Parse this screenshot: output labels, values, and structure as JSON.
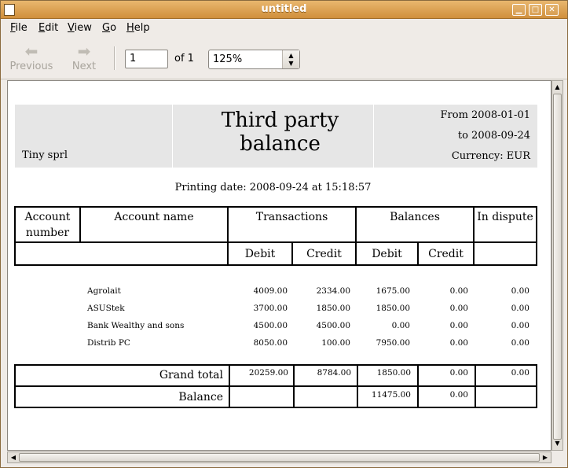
{
  "window": {
    "title": "untitled",
    "minimize": "▁",
    "maximize": "□",
    "close": "✕"
  },
  "menu": [
    {
      "label": "File",
      "u": "F",
      "rest": "ile"
    },
    {
      "label": "Edit",
      "u": "E",
      "rest": "dit"
    },
    {
      "label": "View",
      "u": "V",
      "rest": "iew"
    },
    {
      "label": "Go",
      "u": "G",
      "rest": "o"
    },
    {
      "label": "Help",
      "u": "H",
      "rest": "elp"
    }
  ],
  "toolbar": {
    "previous_label": "Previous",
    "next_label": "Next",
    "page_value": "1",
    "page_of": "of 1",
    "zoom_value": "125%"
  },
  "report": {
    "company": "Tiny sprl",
    "title": "Third party balance",
    "from": "From 2008-01-01",
    "to": "to 2008-09-24",
    "currency": "Currency: EUR",
    "printing_date": "Printing date: 2008-09-24 at 15:18:57",
    "columns": {
      "account_number": "Account number",
      "account_name": "Account name",
      "transactions": "Transactions",
      "balances": "Balances",
      "in_dispute": "In dispute",
      "debit": "Debit",
      "credit": "Credit"
    },
    "rows": [
      {
        "name": "Agrolait",
        "t_debit": "4009.00",
        "t_credit": "2334.00",
        "b_debit": "1675.00",
        "b_credit": "0.00",
        "dispute": "0.00"
      },
      {
        "name": "ASUStek",
        "t_debit": "3700.00",
        "t_credit": "1850.00",
        "b_debit": "1850.00",
        "b_credit": "0.00",
        "dispute": "0.00"
      },
      {
        "name": "Bank Wealthy and sons",
        "t_debit": "4500.00",
        "t_credit": "4500.00",
        "b_debit": "0.00",
        "b_credit": "0.00",
        "dispute": "0.00"
      },
      {
        "name": "Distrib PC",
        "t_debit": "8050.00",
        "t_credit": "100.00",
        "b_debit": "7950.00",
        "b_credit": "0.00",
        "dispute": "0.00"
      }
    ],
    "grand_total": {
      "label": "Grand total",
      "t_debit": "20259.00",
      "t_credit": "8784.00",
      "b_debit": "1850.00",
      "b_credit": "0.00",
      "dispute": "0.00"
    },
    "balance": {
      "label": "Balance",
      "b_debit": "11475.00",
      "b_credit": "0.00"
    }
  }
}
